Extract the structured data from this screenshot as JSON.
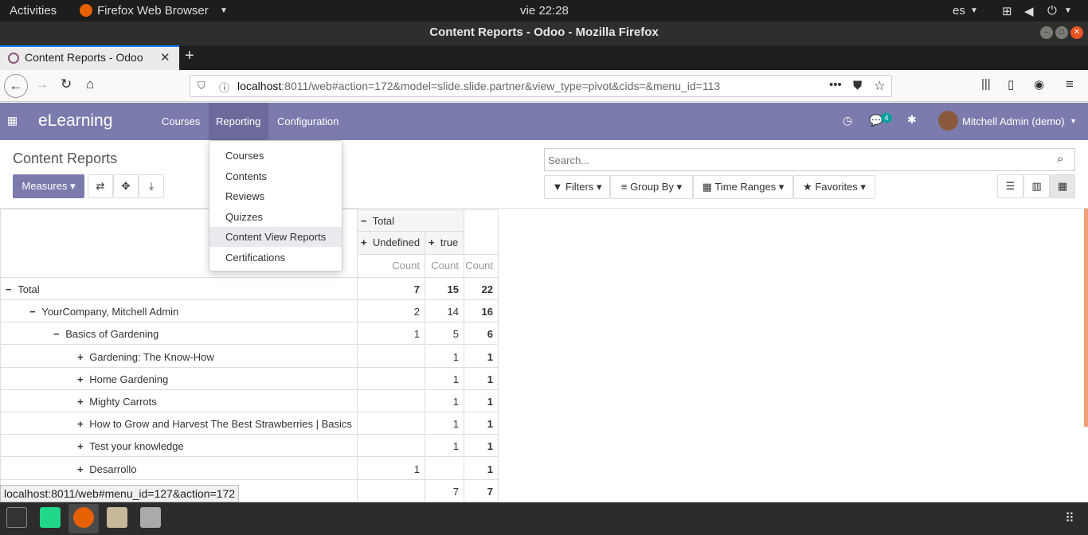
{
  "system": {
    "activities": "Activities",
    "app_menu": "Firefox Web Browser",
    "clock": "vie 22:28",
    "lang": "es"
  },
  "window": {
    "title": "Content Reports - Odoo - Mozilla Firefox"
  },
  "browser": {
    "tab_title": "Content Reports - Odoo",
    "url_host": "localhost",
    "url_rest": ":8011/web#action=172&model=slide.slide.partner&view_type=pivot&cids=&menu_id=113"
  },
  "odoo": {
    "app_name": "eLearning",
    "menu": [
      "Courses",
      "Reporting",
      "Configuration"
    ],
    "chat_badge": "4",
    "user": "Mitchell Admin (demo)"
  },
  "control": {
    "breadcrumb": "Content Reports",
    "measures": "Measures",
    "search_placeholder": "Search...",
    "filters": "Filters",
    "group_by": "Group By",
    "time_ranges": "Time Ranges",
    "favorites": "Favorites"
  },
  "dropdown": {
    "items": [
      "Courses",
      "Contents",
      "Reviews",
      "Quizzes",
      "Content View Reports",
      "Certifications"
    ]
  },
  "pivot": {
    "col_total": "Total",
    "col_undefined": "Undefined",
    "col_true": "true",
    "measure": "Count",
    "rows": [
      {
        "label": "Total",
        "undef": "7",
        "true": "15",
        "total": "22",
        "expanded": true
      },
      {
        "label": "YourCompany, Mitchell Admin",
        "undef": "2",
        "true": "14",
        "total": "16",
        "expanded": true
      },
      {
        "label": "Basics of Gardening",
        "undef": "1",
        "true": "5",
        "total": "6",
        "expanded": true
      },
      {
        "label": "Gardening: The Know-How",
        "undef": "",
        "true": "1",
        "total": "1",
        "expanded": false
      },
      {
        "label": "Home Gardening",
        "undef": "",
        "true": "1",
        "total": "1",
        "expanded": false
      },
      {
        "label": "Mighty Carrots",
        "undef": "",
        "true": "1",
        "total": "1",
        "expanded": false
      },
      {
        "label": "How to Grow and Harvest The Best Strawberries | Basics",
        "undef": "",
        "true": "1",
        "total": "1",
        "expanded": false
      },
      {
        "label": "Test your knowledge",
        "undef": "",
        "true": "1",
        "total": "1",
        "expanded": false
      },
      {
        "label": "Desarrollo",
        "undef": "1",
        "true": "",
        "total": "1",
        "expanded": false
      },
      {
        "label": "",
        "undef": "",
        "true": "7",
        "total": "7",
        "expanded": false
      }
    ]
  },
  "statusbar": "localhost:8011/web#menu_id=127&action=172",
  "colors": {
    "odoo_purple": "#7c7bad",
    "measures_btn": "#7c7bad",
    "accent_scroll": "#f0a07a"
  }
}
